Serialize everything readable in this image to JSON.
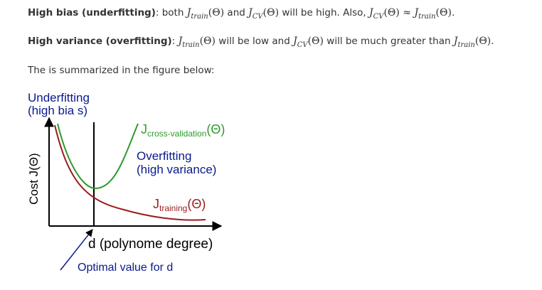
{
  "paragraphs": {
    "bias": {
      "heading": "High bias (underfitting)",
      "text_1": ": both ",
      "text_2": " and ",
      "text_3": " will be high. Also, ",
      "text_4": "."
    },
    "variance": {
      "heading": "High variance (overfitting)",
      "text_1": ": ",
      "text_2": " will be low and ",
      "text_3": " will be much greater than ",
      "text_4": "."
    },
    "summary": "The is summarized in the figure below:"
  },
  "math": {
    "J": "J",
    "train": "train",
    "cv": "CV",
    "theta": "(Θ)",
    "approx": " ≈ "
  },
  "figure": {
    "underfitting_line1": "Underfitting",
    "underfitting_line2": "(high bia s)",
    "cost_label": "Cost J(Θ)",
    "cv_J": "J",
    "cv_sub": "cross-validation",
    "cv_arg": "(Θ)",
    "overfitting_line1": "Overfitting",
    "overfitting_line2": "(high variance)",
    "training_J": "J",
    "training_sub": "training",
    "training_arg": "(Θ)",
    "x_label": "d (polynome degree)",
    "optimal_label": "Optimal value for d",
    "colors": {
      "blue_text": "#0a1a8c",
      "green_curve": "#2e9a2e",
      "red_curve": "#9b1c1c",
      "axis": "#000000"
    }
  }
}
